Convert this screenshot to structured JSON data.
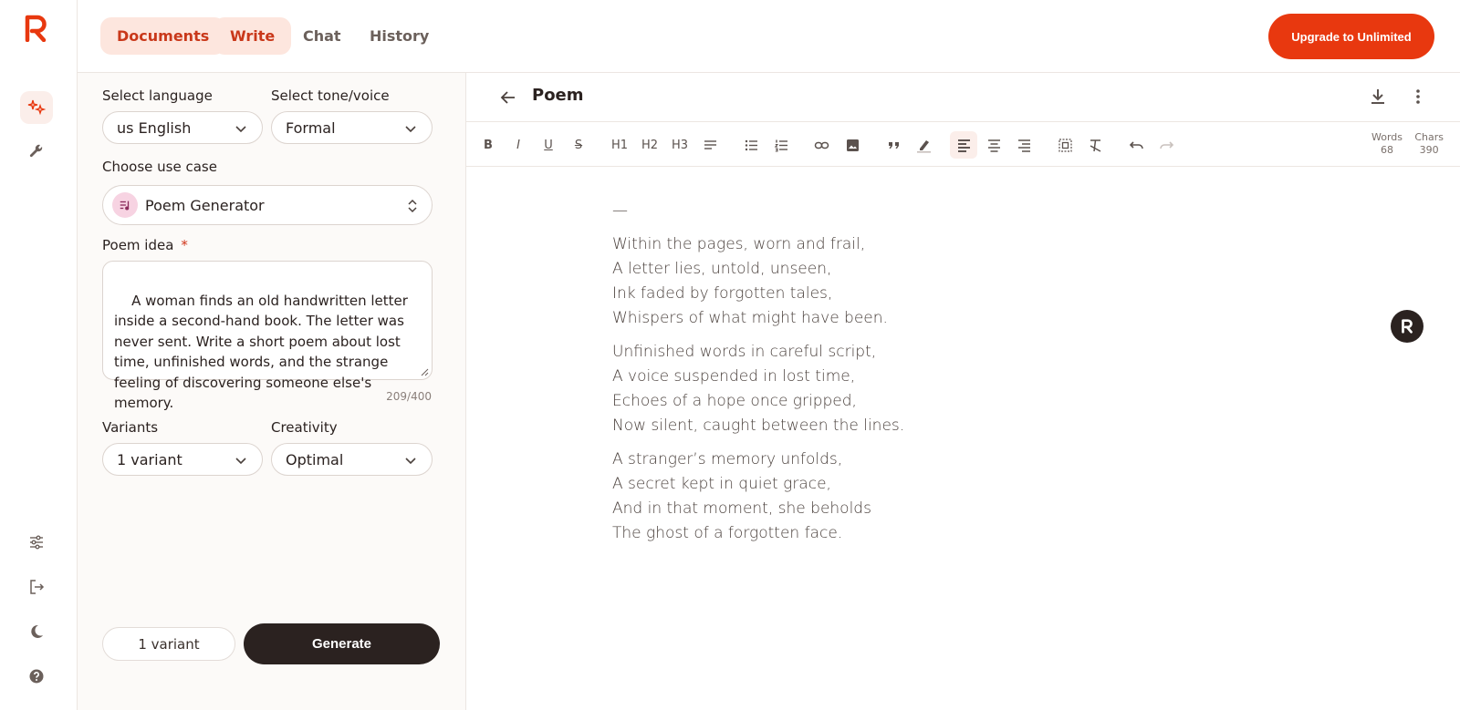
{
  "nav": {
    "tabs": [
      "Documents",
      "Write",
      "Chat",
      "History"
    ],
    "upgrade_label": "Upgrade to Unlimited"
  },
  "form": {
    "language_label": "Select language",
    "language_value": "us English",
    "tone_label": "Select tone/voice",
    "tone_value": "Formal",
    "usecase_label": "Choose use case",
    "usecase_value": "Poem Generator",
    "idea_label": "Poem idea",
    "idea_required": "*",
    "idea_value": "A woman finds an old handwritten letter inside a second-hand book. The letter was never sent. Write a short poem about lost time, unfinished words, and the strange feeling of discovering someone else's memory.",
    "counter": "209/400",
    "variants_label": "Variants",
    "variants_value": "1 variant",
    "creativity_label": "Creativity",
    "creativity_value": "Optimal",
    "variant_pill": "1 variant",
    "generate_label": "Generate"
  },
  "editor": {
    "title": "Poem",
    "toolbar": {
      "bold": "B",
      "italic": "I",
      "underline": "U",
      "strike": "S",
      "h1": "H1",
      "h2": "H2",
      "h3": "H3"
    },
    "words_label": "Words",
    "words_value": "68",
    "chars_label": "Chars",
    "chars_value": "390",
    "dash": "—",
    "poem": [
      [
        "Within the pages, worn and frail,",
        "A letter lies, untold, unseen,",
        "Ink faded by forgotten tales,",
        "Whispers of what might have been."
      ],
      [
        "Unfinished words in careful script,",
        "A voice suspended in lost time,",
        "Echoes of a hope once gripped,",
        "Now silent, caught between the lines."
      ],
      [
        "A stranger’s memory unfolds,",
        "A secret kept in quiet grace,",
        "And in that moment, she beholds",
        "The ghost of a forgotten face."
      ]
    ]
  },
  "colors": {
    "accent": "#e8380f",
    "dark": "#2b2220",
    "active_bg": "#fde6de"
  }
}
